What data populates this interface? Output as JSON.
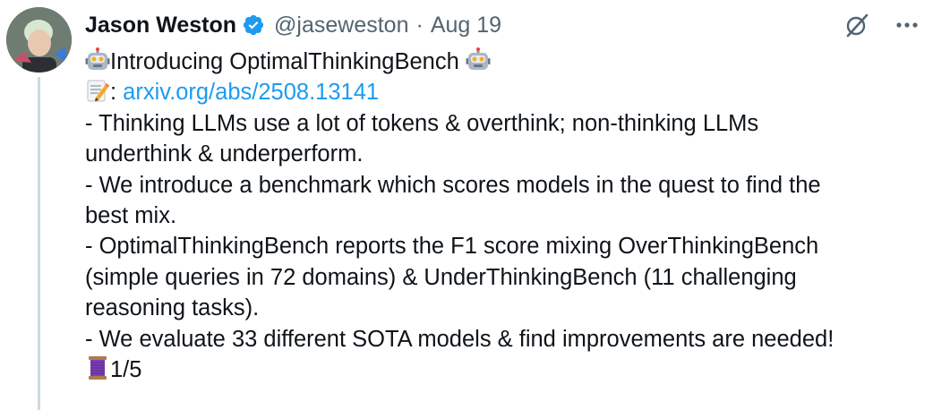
{
  "author": {
    "display_name": "Jason Weston",
    "handle": "@jaseweston",
    "separator": "·",
    "date": "Aug 19",
    "verified": true
  },
  "icons": {
    "verified": "verified-badge-icon",
    "grok": "grok-icon",
    "more": "more-icon",
    "robot": "robot-emoji",
    "memo": "memo-emoji",
    "thread": "thread-spool-emoji"
  },
  "colors": {
    "link": "#1d9bf0",
    "secondary_text": "#536471",
    "verified": "#1d9bf0"
  },
  "tweet": {
    "title": "Introducing OptimalThinkingBench",
    "link_prefix": ": ",
    "link_text": "arxiv.org/abs/2508.13141",
    "lines": [
      "- Thinking LLMs use a lot of tokens & overthink; non-thinking LLMs",
      "underthink & underperform.",
      "- We introduce a benchmark which scores models in the quest to find the",
      "best mix.",
      "- OptimalThinkingBench reports the F1 score mixing OverThinkingBench",
      "(simple queries in 72 domains) & UnderThinkingBench (11 challenging",
      "reasoning tasks).",
      "- We evaluate 33 different SOTA models & find improvements are needed!"
    ],
    "thread_count": "1/5"
  }
}
